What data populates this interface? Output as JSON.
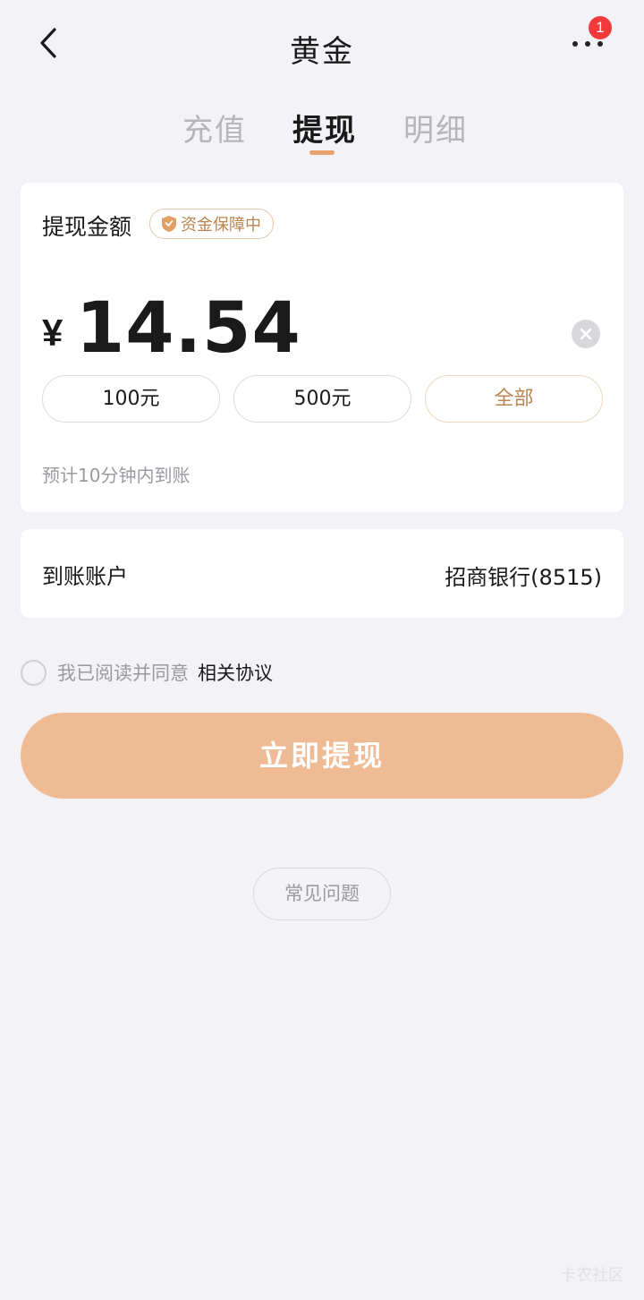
{
  "header": {
    "title": "黄金",
    "notification_count": "1"
  },
  "tabs": [
    {
      "label": "充值",
      "active": false
    },
    {
      "label": "提现",
      "active": true
    },
    {
      "label": "明细",
      "active": false
    }
  ],
  "withdraw": {
    "label": "提现金额",
    "safe_badge": "资金保障中",
    "currency_symbol": "¥",
    "amount": "14.54",
    "quick_amounts": [
      "100元",
      "500元",
      "全部"
    ],
    "arrival_note": "预计10分钟内到账"
  },
  "account": {
    "label": "到账账户",
    "value": "招商银行(8515)"
  },
  "agreement": {
    "text": "我已阅读并同意",
    "link": "相关协议",
    "checked": false
  },
  "submit_label": "立即提现",
  "faq_label": "常见问题",
  "watermark": "卡农社区",
  "colors": {
    "accent": "#e9a26d",
    "submit_bg": "#efbb95",
    "badge_red": "#f23a3a",
    "page_bg": "#f3f2f7"
  }
}
